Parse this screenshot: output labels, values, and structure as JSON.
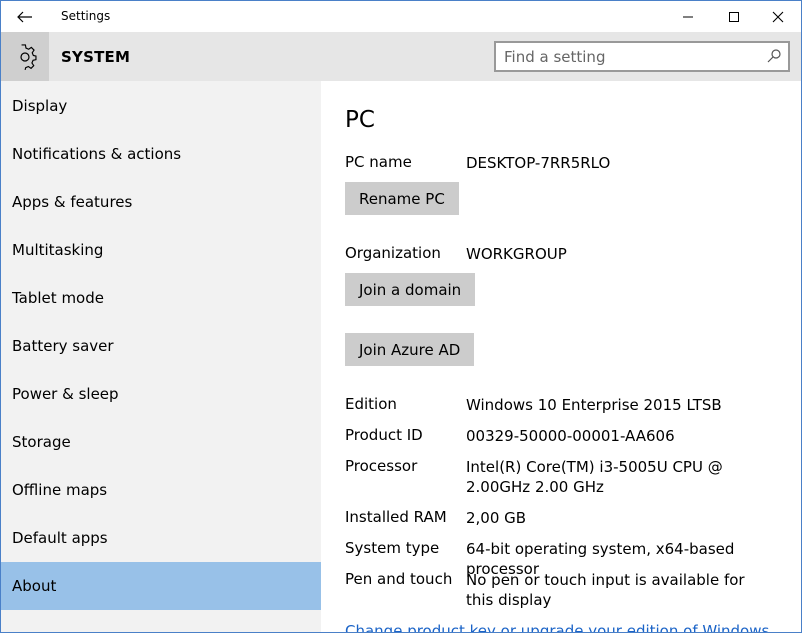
{
  "window": {
    "title": "Settings"
  },
  "header": {
    "section": "SYSTEM",
    "search_placeholder": "Find a setting"
  },
  "sidebar": {
    "items": [
      {
        "label": "Display"
      },
      {
        "label": "Notifications & actions"
      },
      {
        "label": "Apps & features"
      },
      {
        "label": "Multitasking"
      },
      {
        "label": "Tablet mode"
      },
      {
        "label": "Battery saver"
      },
      {
        "label": "Power & sleep"
      },
      {
        "label": "Storage"
      },
      {
        "label": "Offline maps"
      },
      {
        "label": "Default apps"
      },
      {
        "label": "About"
      }
    ],
    "selected": "About"
  },
  "main": {
    "heading": "PC",
    "pc_name": {
      "label": "PC name",
      "value": "DESKTOP-7RR5RLO"
    },
    "rename_button": "Rename PC",
    "organization": {
      "label": "Organization",
      "value": "WORKGROUP"
    },
    "join_domain_button": "Join a domain",
    "join_azure_button": "Join Azure AD",
    "edition": {
      "label": "Edition",
      "value": "Windows 10 Enterprise 2015 LTSB"
    },
    "product_id": {
      "label": "Product ID",
      "value": "00329-50000-00001-AA606"
    },
    "processor": {
      "label": "Processor",
      "value": "Intel(R) Core(TM) i3-5005U CPU @ 2.00GHz 2.00 GHz"
    },
    "ram": {
      "label": "Installed RAM",
      "value": "2,00 GB"
    },
    "system_type": {
      "label": "System type",
      "value": "64-bit operating system, x64-based processor"
    },
    "pen_touch": {
      "label": "Pen and touch",
      "value": "No pen or touch input is available for this display"
    },
    "change_key_link": "Change product key or upgrade your edition of Windows"
  },
  "colors": {
    "selected_nav": "#98c1e8",
    "sidebar_bg": "#f2f2f2",
    "header_bg": "#e6e6e6",
    "button_bg": "#cccccc",
    "link": "#1a63c7"
  }
}
